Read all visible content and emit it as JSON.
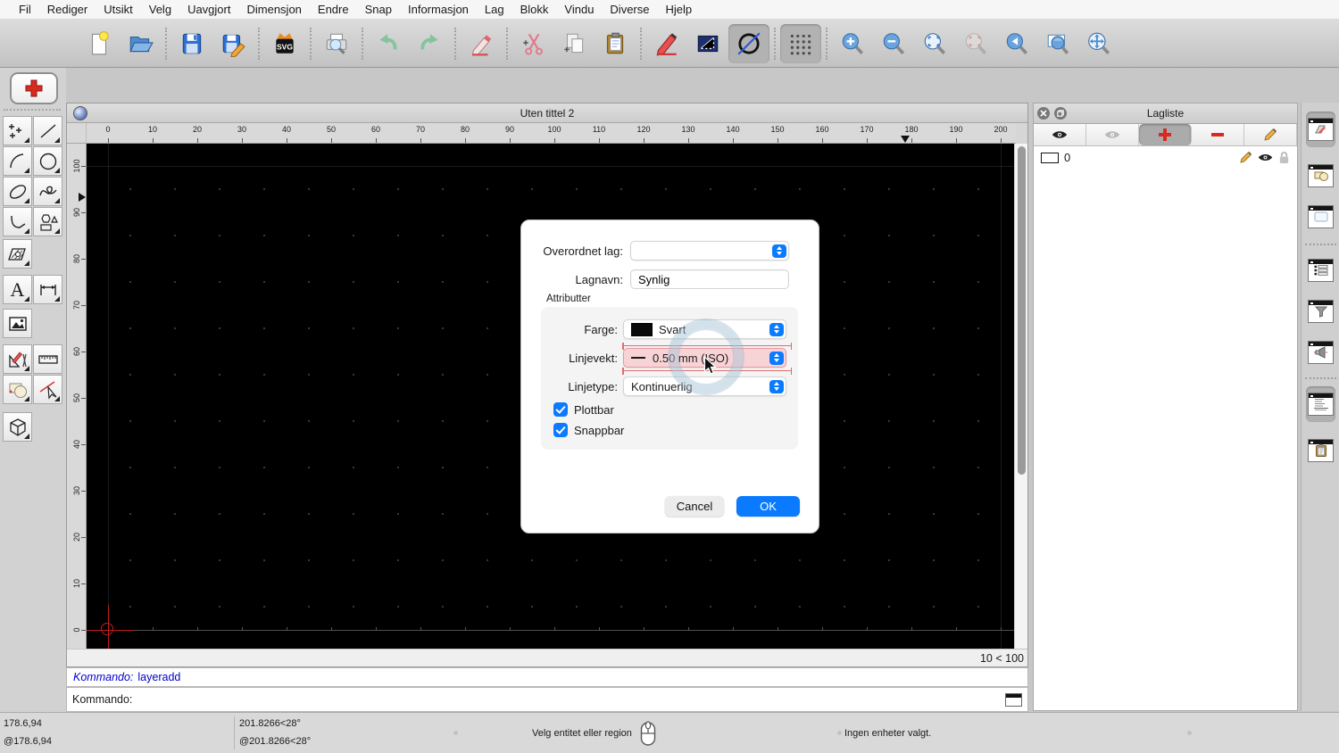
{
  "menu": {
    "items": [
      "Fil",
      "Rediger",
      "Utsikt",
      "Velg",
      "Uavgjort",
      "Dimensjon",
      "Endre",
      "Snap",
      "Informasjon",
      "Lag",
      "Blokk",
      "Vindu",
      "Diverse",
      "Hjelp"
    ]
  },
  "toolbar": {
    "icons": [
      "new-file",
      "open-file",
      "save",
      "save-as",
      "svg-export",
      "print-preview",
      "undo",
      "redo",
      "delete-eraser",
      "cut",
      "copy",
      "paste",
      "edit-attributes",
      "order",
      "draft-mode",
      "grid-toggle",
      "zoom-in",
      "zoom-out",
      "zoom-auto",
      "zoom-previous",
      "zoom-back",
      "zoom-window",
      "zoom-pan"
    ],
    "svg_badge": "SVG"
  },
  "palette": {
    "tools": [
      "points",
      "line",
      "arc",
      "circle",
      "ellipse",
      "spline",
      "polyline",
      "shapes",
      "hatch",
      "text",
      "dimension",
      "image",
      "construction",
      "ruler",
      "modify",
      "select",
      "solid"
    ],
    "text_tool_letter": "A"
  },
  "document": {
    "title": "Uten tittel 2",
    "zoom_info": "10 < 100"
  },
  "rulers": {
    "h_ticks": [
      "0",
      "10",
      "20",
      "30",
      "40",
      "50",
      "60",
      "70",
      "80",
      "90",
      "100",
      "110",
      "120",
      "130",
      "140",
      "150",
      "160",
      "170",
      "180",
      "190",
      "200"
    ],
    "v_ticks": [
      "0",
      "10",
      "20",
      "30",
      "40",
      "50",
      "60",
      "70",
      "80",
      "90",
      "100"
    ]
  },
  "dialog": {
    "parent_layer_label": "Overordnet lag:",
    "layer_name_label": "Lagnavn:",
    "layer_name_value": "Synlig",
    "attributes_label": "Attributter",
    "color_label": "Farge:",
    "color_value": "Svart",
    "linewidth_label": "Linjevekt:",
    "linewidth_value": "0.50 mm (ISO)",
    "linetype_label": "Linjetype:",
    "linetype_value": "Kontinuerlig",
    "plottable_label": "Plottbar",
    "snappable_label": "Snappbar",
    "cancel_label": "Cancel",
    "ok_label": "OK",
    "accent_color": "#0a7bff",
    "highlight_color": "#f8d3d6"
  },
  "layer_panel": {
    "title": "Lagliste",
    "layers": [
      {
        "name": "0"
      }
    ]
  },
  "command": {
    "history_label": "Kommando:",
    "history_value": "layeradd",
    "prompt_label": "Kommando:"
  },
  "status": {
    "coord_abs": "178.6,94",
    "coord_rel": "@178.6,94",
    "polar_abs": "201.8266<28°",
    "polar_rel": "@201.8266<28°",
    "hint": "Velg entitet eller region",
    "selection": "Ingen enheter valgt."
  }
}
